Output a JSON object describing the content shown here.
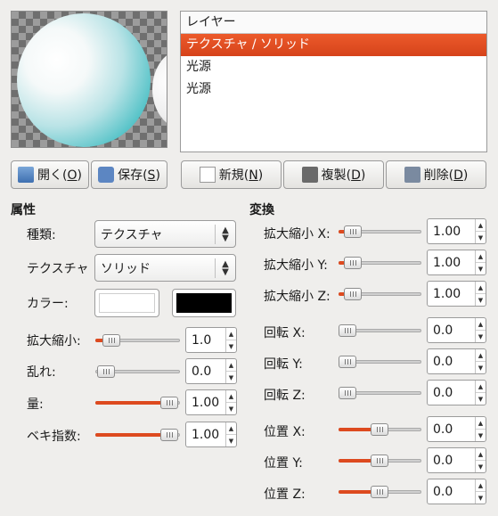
{
  "layers": {
    "header": "レイヤー",
    "items": [
      "テクスチャ / ソリッド",
      "光源",
      "光源"
    ],
    "selected_index": 0
  },
  "buttons": {
    "open": {
      "label": "開く(",
      "key": "O",
      "end": ")"
    },
    "save": {
      "label": "保存(",
      "key": "S",
      "end": ")"
    },
    "new": {
      "label": "新規(",
      "key": "N",
      "end": ")"
    },
    "duplicate": {
      "label": "複製(",
      "key": "D",
      "end": ")"
    },
    "delete": {
      "label": "削除(",
      "key": "D",
      "end": ")"
    }
  },
  "attributes": {
    "heading": "属性",
    "type_label": "種類:",
    "type_value": "テクスチャ",
    "texture_label": "テクスチャ",
    "texture_value": "ソリッド",
    "color_label": "カラー:",
    "color1": "#ffffff",
    "color2": "#000000",
    "scale_label": "拡大縮小:",
    "scale_value": "1.0",
    "turbulence_label": "乱れ:",
    "turbulence_value": "0.0",
    "amount_label": "量:",
    "amount_value": "1.00",
    "exponent_label": "ベキ指数:",
    "exponent_value": "1.00"
  },
  "transform": {
    "heading": "変換",
    "scale_x_label": "拡大縮小 X:",
    "scale_x_value": "1.00",
    "scale_y_label": "拡大縮小 Y:",
    "scale_y_value": "1.00",
    "scale_z_label": "拡大縮小 Z:",
    "scale_z_value": "1.00",
    "rot_x_label": "回転 X:",
    "rot_x_value": "0.0",
    "rot_y_label": "回転 Y:",
    "rot_y_value": "0.0",
    "rot_z_label": "回転 Z:",
    "rot_z_value": "0.0",
    "pos_x_label": "位置 X:",
    "pos_x_value": "0.0",
    "pos_y_label": "位置 Y:",
    "pos_y_value": "0.0",
    "pos_z_label": "位置 Z:",
    "pos_z_value": "0.0"
  },
  "colors": {
    "accent": "#dd4a1f",
    "selection": "#e04f22"
  }
}
